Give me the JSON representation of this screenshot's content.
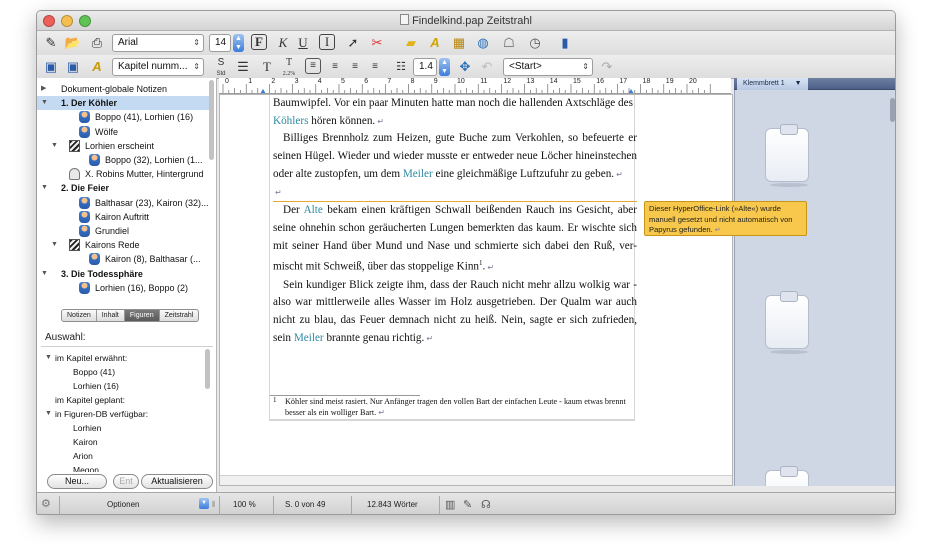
{
  "window": {
    "title": "Findelkind.pap Zeitstrahl"
  },
  "toolbar1": {
    "font_name": "Arial",
    "font_size": "14",
    "bold_label": "F",
    "italic_label": "K",
    "underline_label": "U"
  },
  "toolbar2": {
    "style_name": "Kapitel numm...",
    "line_spacing": "1.4",
    "navigation": "<Start>",
    "std_label": "Std",
    "size_label": "2.2%"
  },
  "tree": {
    "items": [
      {
        "label": "Dokument-globale Notizen",
        "level": 0,
        "bold": false,
        "selected": false,
        "icon": "none",
        "disclosure": "collapsed"
      },
      {
        "label": "1. Der Köhler",
        "level": 0,
        "bold": true,
        "selected": true,
        "icon": "none",
        "disclosure": "expanded"
      },
      {
        "label": "Boppo (41), Lorhien (16)",
        "level": 2,
        "bold": false,
        "selected": false,
        "icon": "figure",
        "disclosure": "none"
      },
      {
        "label": "Wölfe",
        "level": 2,
        "bold": false,
        "selected": false,
        "icon": "figure",
        "disclosure": "none"
      },
      {
        "label": "Lorhien erscheint",
        "level": 1,
        "bold": false,
        "selected": false,
        "icon": "clapper",
        "disclosure": "expanded"
      },
      {
        "label": "Boppo (32), Lorhien (1...",
        "level": 3,
        "bold": false,
        "selected": false,
        "icon": "figure",
        "disclosure": "none"
      },
      {
        "label": "X. Robins Mutter, Hintergrund",
        "level": 1,
        "bold": false,
        "selected": false,
        "icon": "ghost",
        "disclosure": "none"
      },
      {
        "label": "2. Die Feier",
        "level": 0,
        "bold": true,
        "selected": false,
        "icon": "none",
        "disclosure": "expanded"
      },
      {
        "label": "Balthasar (23), Kairon (32)...",
        "level": 2,
        "bold": false,
        "selected": false,
        "icon": "figure",
        "disclosure": "none"
      },
      {
        "label": "Kairon Auftritt",
        "level": 2,
        "bold": false,
        "selected": false,
        "icon": "figure",
        "disclosure": "none"
      },
      {
        "label": "Grundiel",
        "level": 2,
        "bold": false,
        "selected": false,
        "icon": "figure",
        "disclosure": "none"
      },
      {
        "label": "Kairons Rede",
        "level": 1,
        "bold": false,
        "selected": false,
        "icon": "clapper",
        "disclosure": "expanded"
      },
      {
        "label": "Kairon (8), Balthasar (...",
        "level": 3,
        "bold": false,
        "selected": false,
        "icon": "figure",
        "disclosure": "none"
      },
      {
        "label": "3. Die Todessphäre",
        "level": 0,
        "bold": true,
        "selected": false,
        "icon": "none",
        "disclosure": "expanded"
      },
      {
        "label": "Lorhien (16), Boppo (2)",
        "level": 2,
        "bold": false,
        "selected": false,
        "icon": "figure",
        "disclosure": "none"
      }
    ]
  },
  "tabs": [
    {
      "label": "Notizen",
      "active": false
    },
    {
      "label": "Inhalt",
      "active": false
    },
    {
      "label": "Figuren",
      "active": true
    },
    {
      "label": "Zeitstrahl",
      "active": false
    }
  ],
  "selection": {
    "label": "Auswahl:",
    "items": [
      {
        "label": "im Kapitel erwähnt:",
        "indent": 0,
        "disclosure": "expanded"
      },
      {
        "label": "Boppo (41)",
        "indent": 2,
        "disclosure": "none"
      },
      {
        "label": "Lorhien (16)",
        "indent": 2,
        "disclosure": "none"
      },
      {
        "label": "im Kapitel geplant:",
        "indent": 1,
        "disclosure": "none"
      },
      {
        "label": "in Figuren-DB verfügbar:",
        "indent": 0,
        "disclosure": "expanded"
      },
      {
        "label": "Lorhien",
        "indent": 2,
        "disclosure": "none"
      },
      {
        "label": "Kairon",
        "indent": 2,
        "disclosure": "none"
      },
      {
        "label": "Arion",
        "indent": 2,
        "disclosure": "none"
      },
      {
        "label": "Megon",
        "indent": 2,
        "disclosure": "none"
      }
    ]
  },
  "buttons": {
    "new": "Neu...",
    "remove": "Ent",
    "refresh": "Aktualisieren"
  },
  "ruler": {
    "numbers": [
      "0",
      "1",
      "2",
      "3",
      "4",
      "5",
      "6",
      "7",
      "8",
      "9",
      "10",
      "11",
      "12",
      "13",
      "14",
      "15",
      "16",
      "17",
      "18",
      "19",
      "20"
    ]
  },
  "editor": {
    "line1_text": "Baumwipfel. Vor ein paar Minuten hatte man noch die hallenden Axtschläge des",
    "line2_link": "Köhlers",
    "line2_text": " hören können.",
    "para2_text_a": "Billiges Brennholz zum Heizen, gute Buche zum Verkohlen, so befeuerte er seinen Hügel. Wieder und wieder musste er entweder neue Löcher hineinstechen oder alte zustopfen, um dem ",
    "para2_link": "Meiler",
    "para2_text_b": " eine gleichmäßige Luftzufuhr zu geben.",
    "para3_text_a": "Der ",
    "para3_link": "Alte",
    "para3_text_b": " bekam einen kräftigen Schwall beißenden Rauch ins Gesicht, aber seine ohnehin schon geräucherten Lungen bemerkten das kaum. Er wischte sich mit seiner Hand über Mund und Nase und schmierte sich dabei den Ruß, ver-mischt mit Schweiß, über das stoppelige Kinn",
    "para3_footnote_ref": "1",
    "para4_text_a": "Sein kundiger Blick zeigte ihm, dass der Rauch nicht mehr allzu wolkig war - also war mittlerweile alles Wasser im Holz ausgetrieben. Der Qualm war auch nicht zu blau, das Feuer demnach nicht zu heiß. Nein, sagte er sich zufrieden, sein ",
    "para4_link": "Meiler",
    "para4_text_b": " brannte genau richtig.",
    "footnote_num": "1",
    "footnote_text": "Köhler sind meist rasiert. Nur Anfänger tragen den vollen Bart der einfachen Leute - kaum etwas brennt besser als ein wolliger Bart.",
    "link_color": "#2d8aa3"
  },
  "tooltip": {
    "text": "Dieser HyperOffice-Link (»Alte«) wurde manuell gesetzt und nicht automatisch von Papyrus gefunden."
  },
  "clipboard": {
    "tab_label": "Klemmbrett 1"
  },
  "statusbar": {
    "options": "Optionen",
    "zoom": "100 %",
    "page": "S. 0 von 49",
    "words": "12.843 Wörter"
  }
}
